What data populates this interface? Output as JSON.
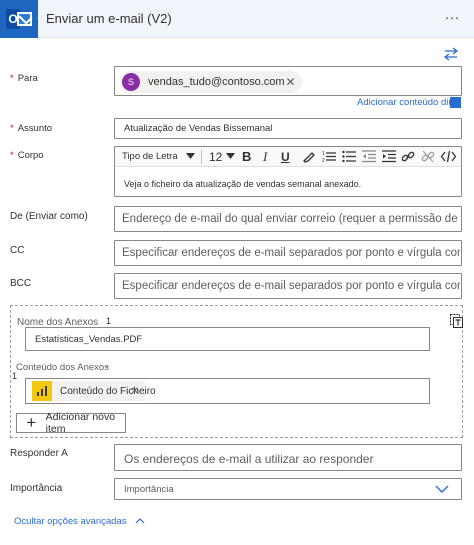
{
  "header": {
    "title": "Enviar um e-mail (V2)",
    "more": "…"
  },
  "fields": {
    "to": {
      "label": "Para",
      "avatar_letter": "S",
      "recipient": "vendas_tudo@contoso.com",
      "remove": "✕",
      "dynamic_link": "Adicionar conteúdo dinâmico"
    },
    "subject": {
      "label": "Assunto",
      "value": "Atualização de Vendas Bissemanal"
    },
    "body": {
      "label": "Corpo",
      "font_select": "Tipo de Letra",
      "font_size": "12",
      "text": "Veja o ficheiro da atualização de vendas semanal anexado."
    },
    "from": {
      "label": "De (Enviar como)",
      "placeholder": "Endereço de e-mail do qual enviar correio (requer a permissão de \"Enviar como\""
    },
    "cc": {
      "label": "CC",
      "placeholder": "Especificar endereços de e-mail separados por ponto e vírgula como alguém@contoso.com"
    },
    "bcc": {
      "label": "BCC",
      "placeholder": "Especificar endereços de e-mail separados por ponto e vírgula como alguém@contoso.com"
    },
    "attachments": {
      "name_label": "Nome dos Anexos",
      "name_index": "1",
      "name_value": "Estatísticas_Vendas.PDF",
      "content_label": "Conteúdo dos Anexos",
      "content_dash": "-",
      "content_index": "1",
      "content_token": "Conteúdo do Ficheiro",
      "add_item": "Adicionar novo item"
    },
    "reply_to": {
      "label": "Responder A",
      "placeholder": "Os endereços de e-mail a utilizar ao responder"
    },
    "importance": {
      "label": "Importância",
      "placeholder": "Importância"
    }
  },
  "footer": {
    "hide_advanced": "Ocultar opções avançadas"
  },
  "colors": {
    "accent": "#2b6cd1",
    "outlook_blue": "#1f66c1",
    "avatar": "#8a2ea8",
    "powerbi_yellow": "#f2c811",
    "required": "#a4262c"
  }
}
